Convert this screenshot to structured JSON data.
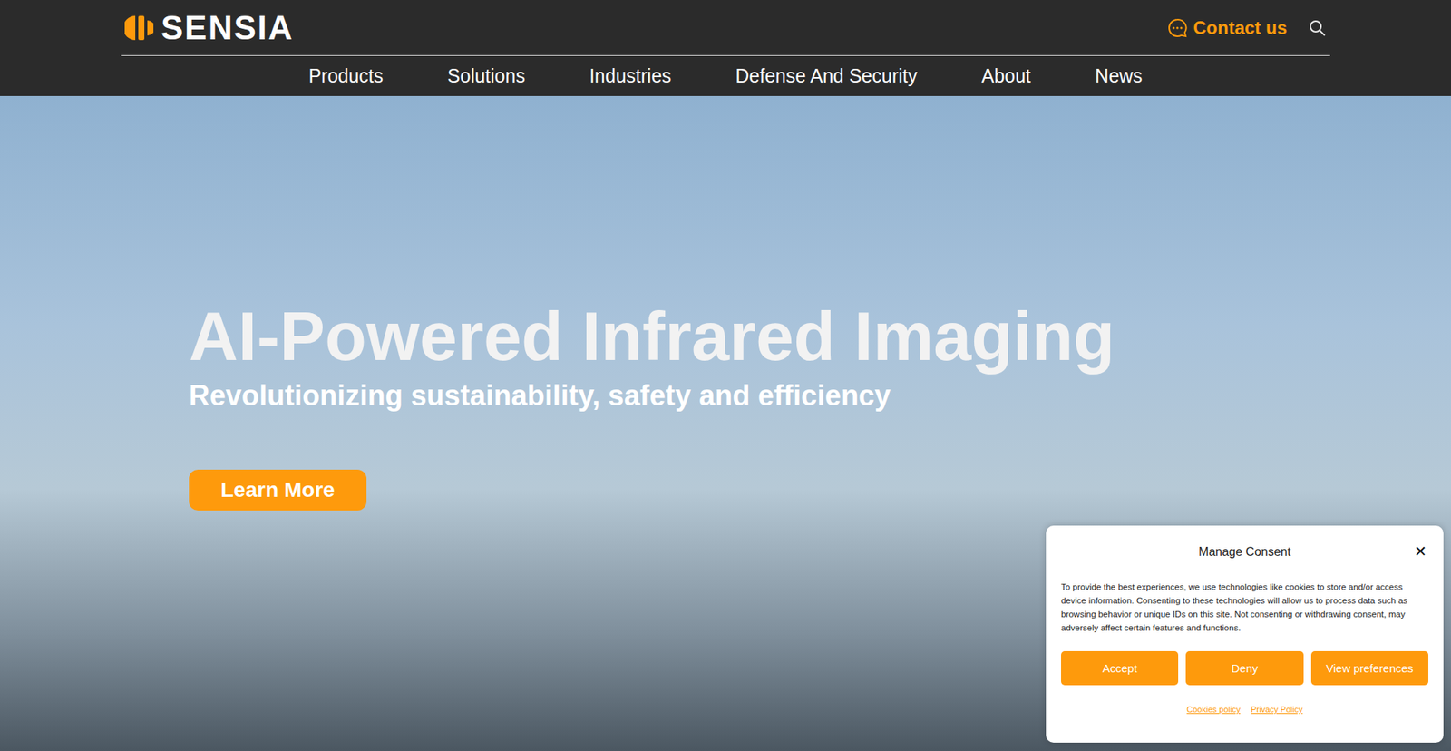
{
  "header": {
    "logo": "SENSIA",
    "contact": "Contact us"
  },
  "nav": {
    "items": [
      "Products",
      "Solutions",
      "Industries",
      "Defense And Security",
      "About",
      "News"
    ]
  },
  "hero": {
    "title": "AI-Powered Infrared Imaging",
    "subtitle": "Revolutionizing sustainability, safety and efficiency",
    "button": "Learn More"
  },
  "consent": {
    "title": "Manage Consent",
    "close": "✕",
    "body": "To provide the best experiences, we use technologies like cookies to store and/or access device information. Consenting to these technologies will allow us to process data such as browsing behavior or unique IDs on this site. Not consenting or withdrawing consent, may adversely affect certain features and functions.",
    "buttons": [
      "Accept",
      "Deny",
      "View preferences"
    ],
    "links": [
      "Cookies policy",
      "Privacy Policy"
    ]
  }
}
